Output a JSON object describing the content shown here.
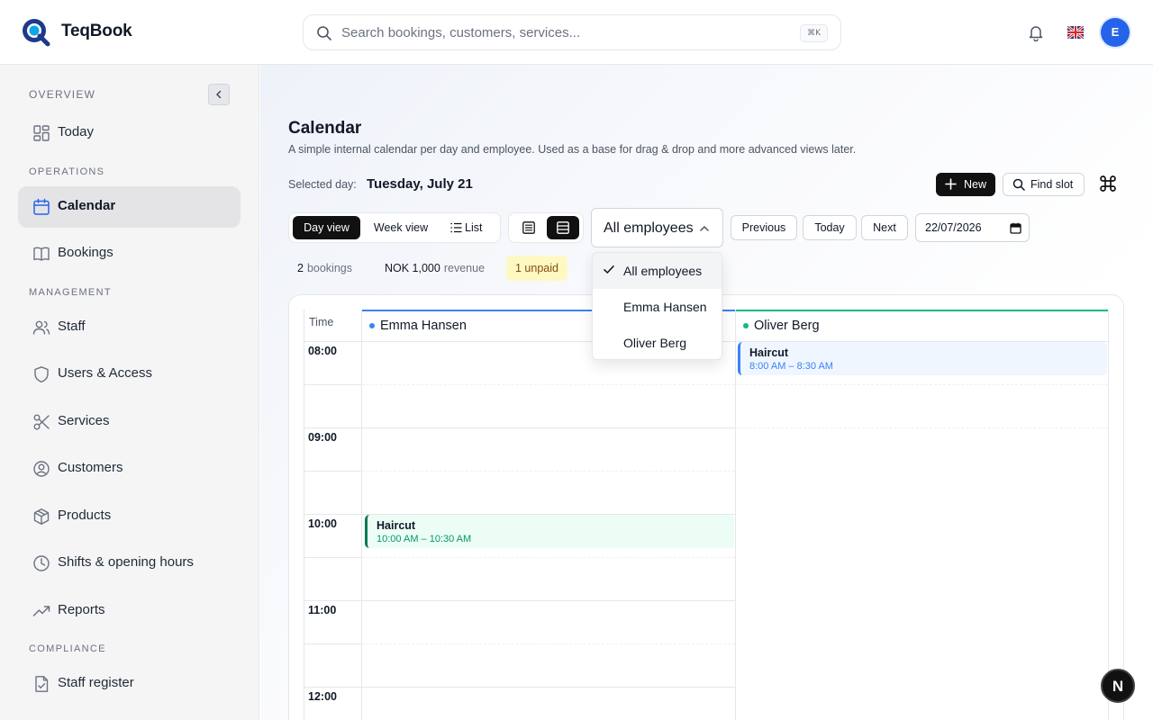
{
  "app": {
    "brand": "TeqBook",
    "search": {
      "placeholder": "Search bookings, customers, services...",
      "shortcut": "⌘K"
    },
    "avatar_initial": "E",
    "accent": "#2563eb"
  },
  "sidebar": {
    "sections": {
      "overview": "OVERVIEW",
      "operations": "OPERATIONS",
      "management": "MANAGEMENT",
      "compliance": "COMPLIANCE"
    },
    "items": [
      {
        "label": "Today",
        "icon": "dashboard-icon"
      },
      {
        "label": "Calendar",
        "icon": "calendar-icon",
        "active": true
      },
      {
        "label": "Bookings",
        "icon": "book-icon"
      },
      {
        "label": "Staff",
        "icon": "users-icon"
      },
      {
        "label": "Users & Access",
        "icon": "shield-icon"
      },
      {
        "label": "Services",
        "icon": "scissors-icon"
      },
      {
        "label": "Customers",
        "icon": "user-circle-icon"
      },
      {
        "label": "Products",
        "icon": "box-icon"
      },
      {
        "label": "Shifts & opening hours",
        "icon": "clock-icon"
      },
      {
        "label": "Reports",
        "icon": "trending-up-icon"
      },
      {
        "label": "Staff register",
        "icon": "file-check-icon"
      }
    ]
  },
  "page": {
    "title": "Calendar",
    "subtitle": "A simple internal calendar per day and employee. Used as a base for drag & drop and more advanced views later.",
    "selected_day_label": "Selected day:",
    "selected_day": "Tuesday, July 21",
    "new_label": "New",
    "find_slot_label": "Find slot"
  },
  "toolbar": {
    "views": [
      "Day view",
      "Week view",
      "List"
    ],
    "active_view": "Day view",
    "employee_filter": "All employees",
    "previous": "Previous",
    "today": "Today",
    "next": "Next",
    "date_value": "22/07/2026"
  },
  "stats": {
    "bookings_count": "2",
    "bookings_label": "bookings",
    "revenue_value": "NOK 1,000",
    "revenue_label": "revenue",
    "unpaid": "1 unpaid"
  },
  "dropdown": {
    "options": [
      "All employees",
      "Emma Hansen",
      "Oliver Berg"
    ],
    "selected": "All employees"
  },
  "calendar": {
    "time_header": "Time",
    "hours": [
      "08:00",
      "09:00",
      "10:00",
      "11:00",
      "12:00"
    ],
    "employees": [
      {
        "name": "Emma Hansen",
        "color": "#3b82f6",
        "events": [
          {
            "title": "Haircut",
            "time": "10:00 AM – 10:30 AM",
            "color": "#047857"
          }
        ]
      },
      {
        "name": "Oliver Berg",
        "color": "#10b981",
        "events": [
          {
            "title": "Haircut",
            "time": "8:00 AM – 8:30 AM",
            "color": "#3b82f6"
          }
        ]
      }
    ]
  },
  "fab_label": "N"
}
